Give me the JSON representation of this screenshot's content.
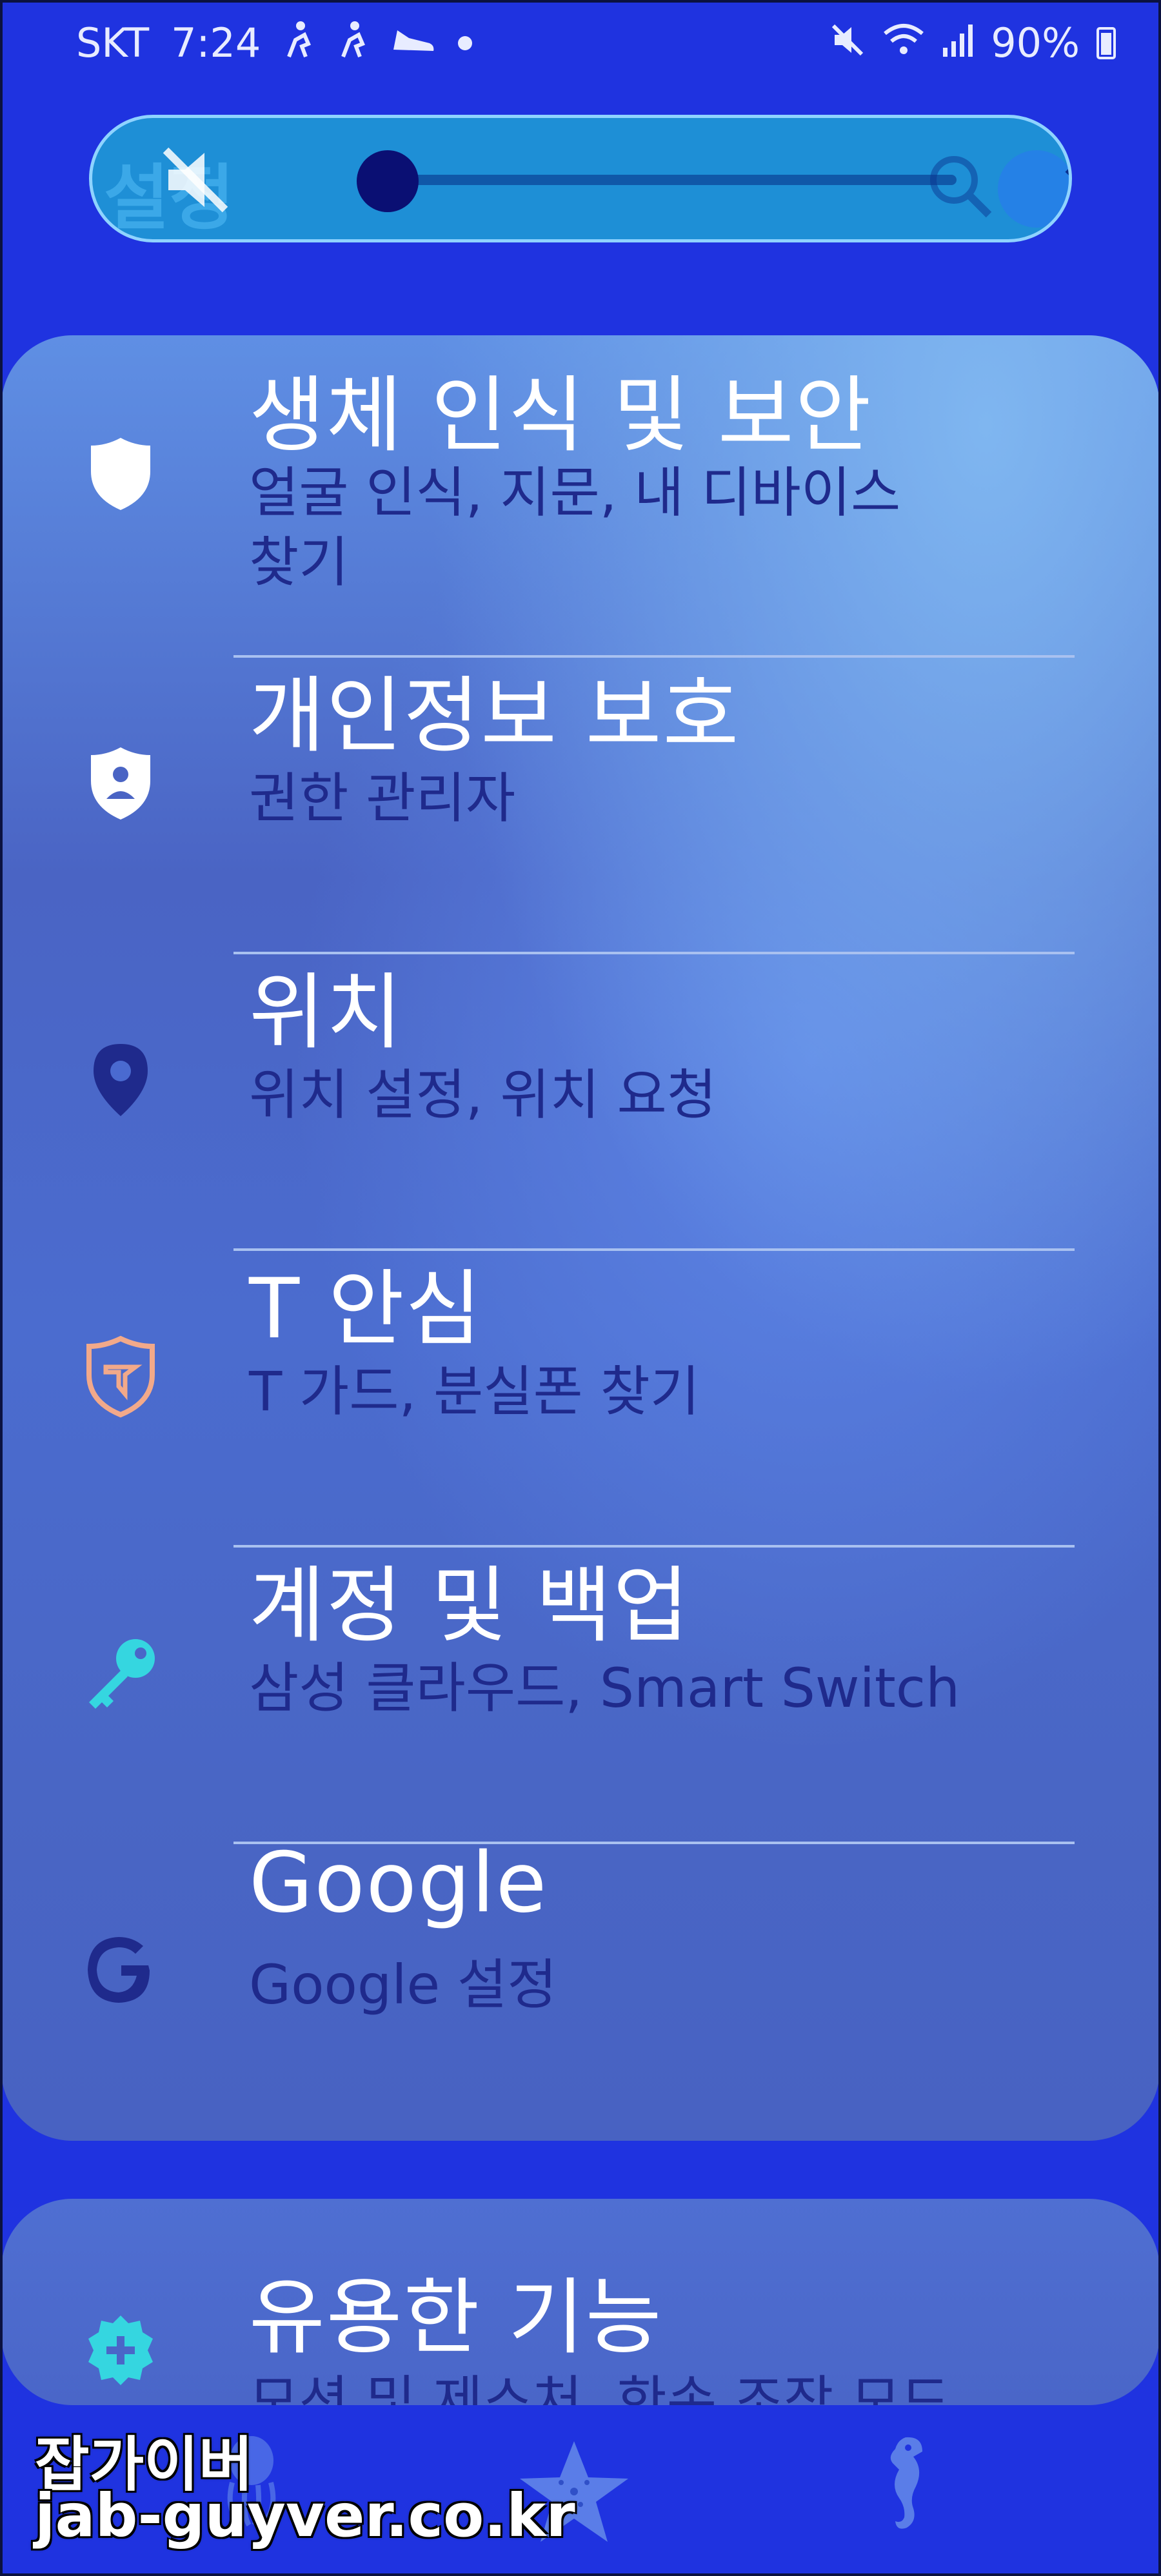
{
  "status_bar": {
    "carrier": "SKT",
    "time": "7:24",
    "battery": "90%",
    "icons": [
      "running-icon",
      "running-icon",
      "sneaker-icon",
      "dot-icon",
      "mute-icon",
      "wifi-icon",
      "signal-icon",
      "battery-icon"
    ]
  },
  "volume_panel": {
    "ghost_title": "설정",
    "level": 0.0,
    "icons": [
      "mute-icon",
      "search-icon",
      "chevron-down-icon"
    ]
  },
  "settings": {
    "items": [
      {
        "title": "생체 인식 및 보안",
        "subtitle": "얼굴 인식, 지문, 내 디바이스 찾기",
        "icon": "shield-icon",
        "icon_color": "#ffffff"
      },
      {
        "title": "개인정보 보호",
        "subtitle": "권한 관리자",
        "icon": "privacy-shield-icon",
        "icon_color": "#ffffff"
      },
      {
        "title": "위치",
        "subtitle": "위치 설정, 위치 요청",
        "icon": "location-pin-icon",
        "icon_color": "#1f2a8c"
      },
      {
        "title": "T 안심",
        "subtitle": "T 가드, 분실폰 찾기",
        "icon": "t-guard-icon",
        "icon_color": "#f2a98a"
      },
      {
        "title": "계정 및 백업",
        "subtitle": "삼성 클라우드, Smart Switch",
        "icon": "key-icon",
        "icon_color": "#35d6e0"
      },
      {
        "title": "Google",
        "subtitle": "Google 설정",
        "icon": "google-icon",
        "icon_color": "#1f2a8c"
      }
    ],
    "next_item": {
      "title": "유용한 기능",
      "subtitle": "모션 및 제스처, 한손 조작 모드",
      "icon": "gear-plus-icon",
      "icon_color": "#35d6e0"
    }
  },
  "bottom_nav": {
    "icons": [
      "octopus-icon",
      "starfish-icon",
      "seahorse-icon"
    ]
  },
  "watermark": {
    "line1": "잡가이버",
    "line2": "jab-guyver.co.kr"
  },
  "colors": {
    "background": "#1f33e0",
    "card": "#4a66c8",
    "subtitle": "#1f2a8c"
  }
}
